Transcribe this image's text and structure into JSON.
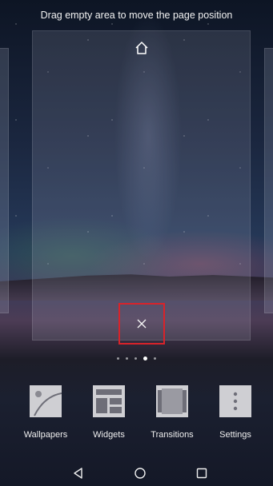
{
  "hint": "Drag empty area to move the page position",
  "page_indicator": {
    "total": 6,
    "active_index": 4
  },
  "options": [
    {
      "label": "Wallpapers",
      "icon": "wallpaper-icon"
    },
    {
      "label": "Widgets",
      "icon": "widgets-icon"
    },
    {
      "label": "Transitions",
      "icon": "transitions-icon"
    },
    {
      "label": "Settings",
      "icon": "settings-icon"
    }
  ],
  "nav": {
    "back": "back-icon",
    "home": "home-nav-icon",
    "recents": "recents-icon"
  },
  "colors": {
    "highlight": "#d8232a"
  }
}
